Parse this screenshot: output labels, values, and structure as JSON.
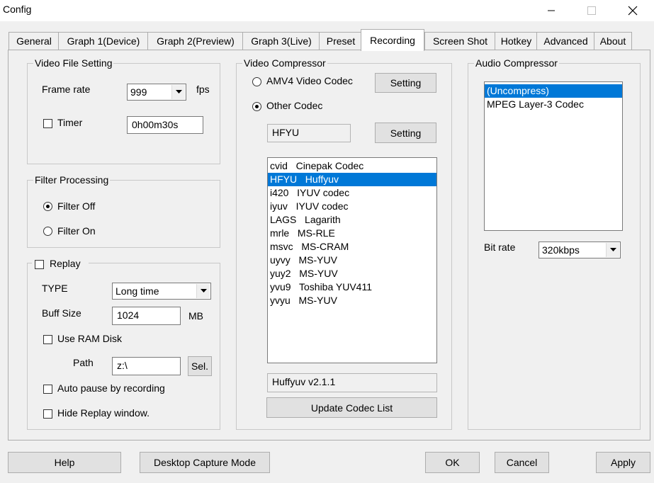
{
  "window": {
    "title": "Config"
  },
  "tabs": [
    {
      "label": "General",
      "active": false
    },
    {
      "label": "Graph 1(Device)",
      "active": false
    },
    {
      "label": "Graph 2(Preview)",
      "active": false
    },
    {
      "label": "Graph 3(Live)",
      "active": false
    },
    {
      "label": "Preset",
      "active": false
    },
    {
      "label": "Recording",
      "active": true
    },
    {
      "label": "Screen Shot",
      "active": false
    },
    {
      "label": "Hotkey",
      "active": false
    },
    {
      "label": "Advanced",
      "active": false
    },
    {
      "label": "About",
      "active": false
    }
  ],
  "video_file": {
    "group_label": "Video File Setting",
    "frame_rate_label": "Frame rate",
    "frame_rate_value": "999",
    "fps_label": "fps",
    "timer_label": "Timer",
    "timer_checked": false,
    "timer_value": "0h00m30s"
  },
  "filter": {
    "group_label": "Filter Processing",
    "off_label": "Filter Off",
    "on_label": "Filter On",
    "selected": "off"
  },
  "replay": {
    "label": "Replay",
    "checked": false,
    "type_label": "TYPE",
    "type_value": "Long time",
    "buff_label": "Buff Size",
    "buff_value": "1024",
    "mb_label": "MB",
    "ram_disk_label": "Use RAM Disk",
    "ram_disk_checked": false,
    "path_label": "Path",
    "path_value": "z:\\",
    "sel_label": "Sel.",
    "auto_pause_label": "Auto pause by recording",
    "auto_pause_checked": false,
    "hide_label": "Hide Replay window.",
    "hide_checked": false
  },
  "video_compressor": {
    "group_label": "Video Compressor",
    "amv4_label": "AMV4 Video Codec",
    "other_label": "Other Codec",
    "selected": "other",
    "setting_label": "Setting",
    "codec_field": "HFYU",
    "codecs": [
      {
        "code": "cvid",
        "name": "Cinepak Codec"
      },
      {
        "code": "HFYU",
        "name": "Huffyuv"
      },
      {
        "code": "i420",
        "name": "IYUV codec"
      },
      {
        "code": "iyuv",
        "name": "IYUV codec"
      },
      {
        "code": "LAGS",
        "name": "Lagarith"
      },
      {
        "code": "mrle",
        "name": "MS-RLE"
      },
      {
        "code": "msvc",
        "name": "MS-CRAM"
      },
      {
        "code": "uyvy",
        "name": "MS-YUV"
      },
      {
        "code": "yuy2",
        "name": "MS-YUV"
      },
      {
        "code": "yvu9",
        "name": "Toshiba YUV411"
      },
      {
        "code": "yvyu",
        "name": "MS-YUV"
      }
    ],
    "selected_codec_index": 1,
    "codec_description": "Huffyuv v2.1.1",
    "update_label": "Update Codec List"
  },
  "audio_compressor": {
    "group_label": "Audio Compressor",
    "items": [
      "(Uncompress)",
      "MPEG Layer-3 Codec"
    ],
    "selected_index": 0,
    "bitrate_label": "Bit rate",
    "bitrate_value": "320kbps"
  },
  "bottom": {
    "help": "Help",
    "desktop_capture": "Desktop Capture Mode",
    "ok": "OK",
    "cancel": "Cancel",
    "apply": "Apply"
  }
}
